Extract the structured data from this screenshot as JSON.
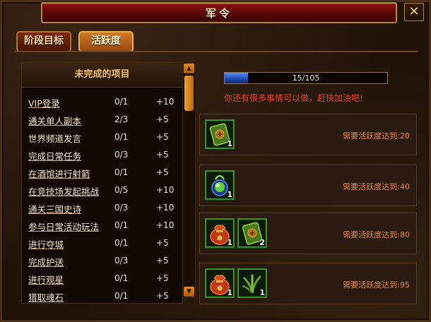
{
  "window": {
    "title": "军令",
    "close": "✕"
  },
  "tabs": [
    {
      "label": "阶段目标"
    },
    {
      "label": "活跃度"
    }
  ],
  "list": {
    "header": "未完成的项目",
    "items": [
      {
        "name": "VIP登录",
        "progress": "0/1",
        "points": "+10"
      },
      {
        "name": "通关单人副本",
        "progress": "2/3",
        "points": "+5"
      },
      {
        "name": "世界频道发言",
        "progress": "0/1",
        "points": "+5"
      },
      {
        "name": "完成日常任务",
        "progress": "0/3",
        "points": "+5"
      },
      {
        "name": "在酒馆进行射箭",
        "progress": "0/1",
        "points": "+5"
      },
      {
        "name": "在竞技场发起挑战",
        "progress": "0/5",
        "points": "+10"
      },
      {
        "name": "通关三国史诗",
        "progress": "0/3",
        "points": "+10"
      },
      {
        "name": "参与日常活动玩法",
        "progress": "0/1",
        "points": "+10"
      },
      {
        "name": "进行夺城",
        "progress": "0/1",
        "points": "+5"
      },
      {
        "name": "完成护送",
        "progress": "0/3",
        "points": "+5"
      },
      {
        "name": "进行观星",
        "progress": "0/1",
        "points": "+5"
      },
      {
        "name": "猎取魂石",
        "progress": "0/1",
        "points": "+5"
      }
    ]
  },
  "activity": {
    "progress_text": "15/105",
    "current": 15,
    "max": 105,
    "hint": "你还有很多事情可以做，赶快加油吧!"
  },
  "rewards": [
    {
      "requirement": "需要活跃度达到:20",
      "items": [
        {
          "icon": "green-scroll-icon",
          "count": "1"
        }
      ]
    },
    {
      "requirement": "需要活跃度达到:40",
      "items": [
        {
          "icon": "green-orb-icon",
          "count": "1"
        }
      ]
    },
    {
      "requirement": "需要活跃度达到:80",
      "items": [
        {
          "icon": "red-pouch-icon",
          "count": "1"
        },
        {
          "icon": "green-scroll-icon",
          "count": "2"
        }
      ]
    },
    {
      "requirement": "需要活跃度达到:95",
      "items": [
        {
          "icon": "red-pouch-icon",
          "count": "1"
        },
        {
          "icon": "green-herb-icon",
          "count": "1"
        }
      ]
    }
  ]
}
